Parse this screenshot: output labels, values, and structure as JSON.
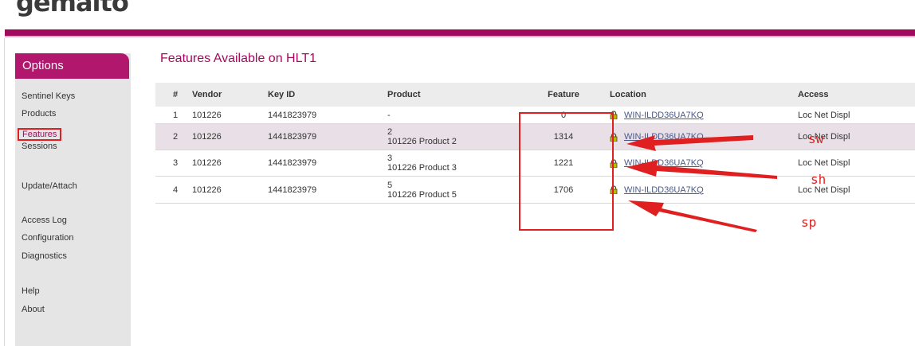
{
  "brand": {
    "name": "gemalto"
  },
  "colors": {
    "brand": "#a20a5e",
    "annotation": "#e02020",
    "row_highlight": "#e8e0e6"
  },
  "sidebar": {
    "header": "Options",
    "items": [
      {
        "label": "Sentinel Keys"
      },
      {
        "label": "Products"
      },
      {
        "label": "Features",
        "active": true
      },
      {
        "label": "Sessions"
      },
      {
        "label": "Update/Attach"
      },
      {
        "label": "Access Log"
      },
      {
        "label": "Configuration"
      },
      {
        "label": "Diagnostics"
      },
      {
        "label": "Help"
      },
      {
        "label": "About"
      }
    ]
  },
  "main": {
    "title": "Features Available on HLT1",
    "columns": [
      "#",
      "Vendor",
      "Key ID",
      "Product",
      "Feature",
      "Location",
      "Access"
    ],
    "rows": [
      {
        "num": "1",
        "vendor": "101226",
        "key_id": "1441823979",
        "product_id": "-",
        "product_name": "",
        "feature": "0",
        "location": "WIN-ILDD36UA7KQ",
        "access": "Loc Net Displ",
        "icon": "lock-icon"
      },
      {
        "num": "2",
        "vendor": "101226",
        "key_id": "1441823979",
        "product_id": "2",
        "product_name": "101226 Product 2",
        "feature": "1314",
        "location": "WIN-ILDD36UA7KQ",
        "access": "Loc Net Displ",
        "icon": "lock-icon"
      },
      {
        "num": "3",
        "vendor": "101226",
        "key_id": "1441823979",
        "product_id": "3",
        "product_name": "101226 Product 3",
        "feature": "1221",
        "location": "WIN-ILDD36UA7KQ",
        "access": "Loc Net Displ",
        "icon": "lock-icon"
      },
      {
        "num": "4",
        "vendor": "101226",
        "key_id": "1441823979",
        "product_id": "5",
        "product_name": "101226 Product 5",
        "feature": "1706",
        "location": "WIN-ILDD36UA7KQ",
        "access": "Loc Net Displ",
        "icon": "lock-icon"
      }
    ]
  },
  "annotations": {
    "labels": [
      "sw",
      "sh",
      "sp"
    ]
  }
}
